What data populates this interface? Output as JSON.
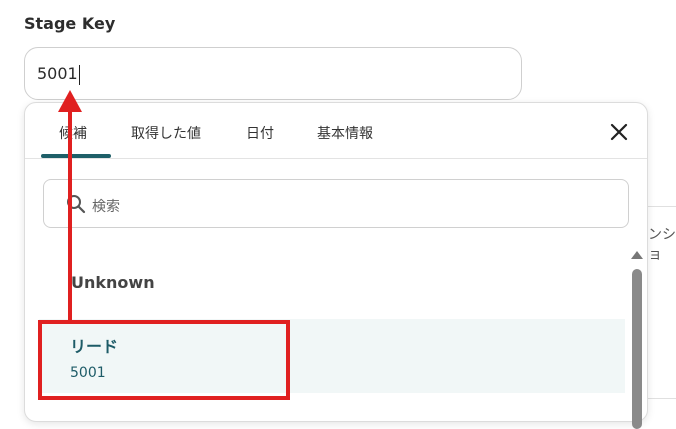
{
  "field": {
    "label": "Stage Key",
    "value": "5001"
  },
  "background": {
    "truncated_text": "ンショ"
  },
  "popup": {
    "tabs": [
      {
        "label": "候補"
      },
      {
        "label": "取得した値"
      },
      {
        "label": "日付"
      },
      {
        "label": "基本情報"
      }
    ],
    "active_tab": "候補",
    "search": {
      "placeholder": "検索"
    },
    "items": [
      {
        "title": "Unknown"
      },
      {
        "title": "リード",
        "value": "5001",
        "selected": true
      }
    ]
  },
  "colors": {
    "accent": "#1e5f68",
    "annotation": "#e02020",
    "selected_bg": "#f1f7f7"
  },
  "icons": {
    "close": "close-icon",
    "search": "search-icon",
    "scroll_up": "scroll-up-icon"
  }
}
